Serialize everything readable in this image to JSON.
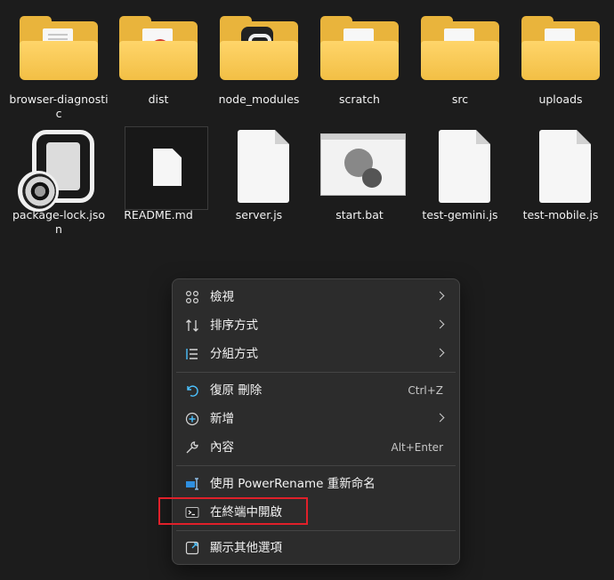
{
  "files": [
    {
      "name": "browser-diagnostic",
      "type": "folder-paper"
    },
    {
      "name": "dist",
      "type": "folder-red"
    },
    {
      "name": "node_modules",
      "type": "folder-node"
    },
    {
      "name": "scratch",
      "type": "folder"
    },
    {
      "name": "src",
      "type": "folder"
    },
    {
      "name": "uploads",
      "type": "folder"
    },
    {
      "name": "package-lock.json",
      "type": "json"
    },
    {
      "name": "README.md",
      "type": "md"
    },
    {
      "name": "server.js",
      "type": "js"
    },
    {
      "name": "start.bat",
      "type": "bat"
    },
    {
      "name": "test-gemini.js",
      "type": "js"
    },
    {
      "name": "test-mobile.js",
      "type": "js"
    }
  ],
  "context_menu": {
    "items": [
      {
        "label": "檢視",
        "icon": "grid-icon",
        "submenu": true
      },
      {
        "label": "排序方式",
        "icon": "sort-icon",
        "submenu": true
      },
      {
        "label": "分組方式",
        "icon": "group-icon",
        "submenu": true
      },
      {
        "label": "復原 刪除",
        "icon": "undo-icon",
        "shortcut": "Ctrl+Z"
      },
      {
        "label": "新增",
        "icon": "new-icon",
        "submenu": true
      },
      {
        "label": "內容",
        "icon": "wrench-icon",
        "shortcut": "Alt+Enter"
      },
      {
        "label": "使用 PowerRename 重新命名",
        "icon": "powerrename-icon"
      },
      {
        "label": "在終端中開啟",
        "icon": "terminal-icon"
      },
      {
        "label": "顯示其他選項",
        "icon": "more-options-icon"
      }
    ]
  },
  "colors": {
    "accent": "#4cc2ff",
    "highlight_box": "#e0202a",
    "folder": "#f2bf45"
  }
}
